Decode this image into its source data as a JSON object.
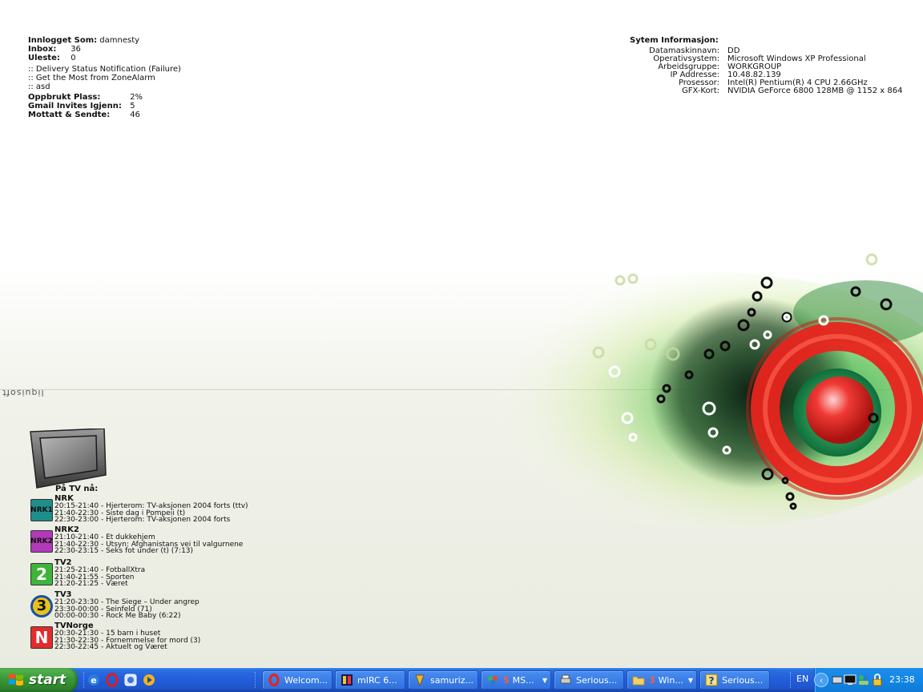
{
  "mail": {
    "logged_in_label": "Innlogget Som:",
    "logged_in_value": "damnesty",
    "inbox_label": "Inbox:",
    "inbox_value": "36",
    "unread_label": "Uleste:",
    "unread_value": "0",
    "items": [
      ":: Delivery Status Notification (Failure)",
      ":: Get the Most from ZoneAlarm",
      ":: asd"
    ],
    "used_label": "Oppbrukt Plass:",
    "used_value": "2%",
    "invites_label": "Gmail Invites Igjenn:",
    "invites_value": "5",
    "received_label": "Mottatt & Sendte:",
    "received_value": "46"
  },
  "system": {
    "title": "Sytem Informasjon:",
    "rows": [
      {
        "label": "Datamaskinnavn:",
        "value": "DD"
      },
      {
        "label": "Operativsystem:",
        "value": "Microsoft Windows XP Professional"
      },
      {
        "label": "Arbeidsgruppe:",
        "value": "WORKGROUP"
      },
      {
        "label": "IP Addresse:",
        "value": "10.48.82.139"
      },
      {
        "label": "Prosessor:",
        "value": "Intel(R) Pentium(R) 4 CPU 2.66GHz"
      },
      {
        "label": "GFX-Kort:",
        "value": "NVIDIA GeForce 6800 128MB @ 1152 x 864"
      }
    ]
  },
  "wallpaper": {
    "signature": "liquisoft"
  },
  "tv": {
    "title": "På TV nå:",
    "channels": [
      {
        "name": "NRK",
        "logo_text": "NRK1",
        "logo_color": "#1f8e8a",
        "programs": [
          "20:15-21:40 - Hjerterom: TV-aksjonen 2004 forts (ttv)",
          "21:40-22:30 - Siste dag i Pompeii (t)",
          "22:30-23:00 - Hjerterom: TV-aksjonen 2004 forts"
        ]
      },
      {
        "name": "NRK2",
        "logo_text": "NRK2",
        "logo_color": "#b23ab8",
        "programs": [
          "21:10-21:40 - Et dukkehjem",
          "21:40-22:30 - Utsyn: Afghanistans vei til valgurnene",
          "22:30-23:15 - Seks fot under (t)  (7:13)"
        ]
      },
      {
        "name": "TV2",
        "logo_text": "2",
        "logo_color": "#3fb43a",
        "programs": [
          "21:25-21:40 - FotballXtra",
          "21:40-21:55 - Sporten",
          "21:20-21:25 - Været"
        ]
      },
      {
        "name": "TV3",
        "logo_text": "3",
        "logo_color": "#e8c21a",
        "programs": [
          "21:20-23:30 - The Siege – Under angrep",
          "23:30-00:00 - Seinfeld (71)",
          "00:00-00:30 - Rock Me Baby (6:22)"
        ]
      },
      {
        "name": "TVNorge",
        "logo_text": "N",
        "logo_color": "#e22b2b",
        "programs": [
          "20:30-21:30 - 15 barn i huset",
          "21:30-22:30 - Fornemmelse for mord (3)",
          "22:30-22:45 - Aktuelt og Været"
        ]
      }
    ]
  },
  "taskbar": {
    "start_label": "start",
    "quick_launch": [
      "ie-icon",
      "opera-icon",
      "messenger-icon",
      "media-player-icon"
    ],
    "tasks": [
      {
        "label": "Welcom...",
        "icon": "opera-icon",
        "count": ""
      },
      {
        "label": "mIRC 6...",
        "icon": "mirc-icon",
        "count": ""
      },
      {
        "label": "samuriz...",
        "icon": "winamp-icon",
        "count": ""
      },
      {
        "label": "MS...",
        "icon": "msn-icon",
        "count": "5"
      },
      {
        "label": "Serious...",
        "icon": "printer-icon",
        "count": ""
      },
      {
        "label": "Win...",
        "icon": "folder-icon",
        "count": "3"
      },
      {
        "label": "Serious...",
        "icon": "help-icon",
        "count": ""
      }
    ],
    "language": "EN",
    "clock": "23:38"
  },
  "colors": {
    "taskbar_blue": "#245edb",
    "start_green": "#3c9a3a",
    "tray_blue": "#1387e6"
  }
}
